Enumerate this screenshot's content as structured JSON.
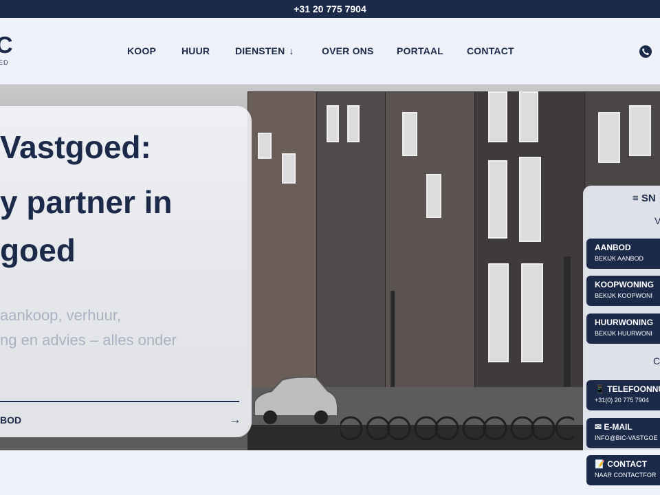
{
  "topbar": {
    "phone": "+31 20 775 7904"
  },
  "logo": {
    "mark": "C",
    "sub": "ED"
  },
  "nav": {
    "items": [
      {
        "label": "KOOP"
      },
      {
        "label": "HUUR"
      },
      {
        "label": "DIENSTEN"
      },
      {
        "label": "OVER ONS"
      },
      {
        "label": "PORTAAL"
      },
      {
        "label": "CONTACT"
      }
    ],
    "diensten_chevron": "↓",
    "phone_icon": "phone-icon"
  },
  "hero": {
    "title_lines": [
      "Vastgoed:",
      "y partner in",
      "goed"
    ],
    "lead_lines": [
      "aankoop, verhuur,",
      "ng en advies – alles onder"
    ],
    "link_label": "BOD",
    "link_arrow": "→"
  },
  "sidebar": {
    "title": "≡ SN",
    "subtitle": "V",
    "section_label": "C",
    "buttons": [
      {
        "title": "AANBOD",
        "sub": "BEKIJK AANBOD"
      },
      {
        "title": "KOOPWONING",
        "sub": "BEKIJK KOOPWONI"
      },
      {
        "title": "HUURWONING",
        "sub": "BEKIJK HUURWONI"
      },
      {
        "title": "📱 TELEFOONNUM",
        "sub": "+31(0) 20 775 7904"
      },
      {
        "title": "✉ E-MAIL",
        "sub": "INFO@BIC-VASTGOE"
      },
      {
        "title": "📝 CONTACT",
        "sub": "NAAR CONTACTFOR"
      }
    ]
  },
  "colors": {
    "navy": "#1c2a4a",
    "page_bg": "#eef2f8",
    "lead_gray": "#aab2c2"
  }
}
